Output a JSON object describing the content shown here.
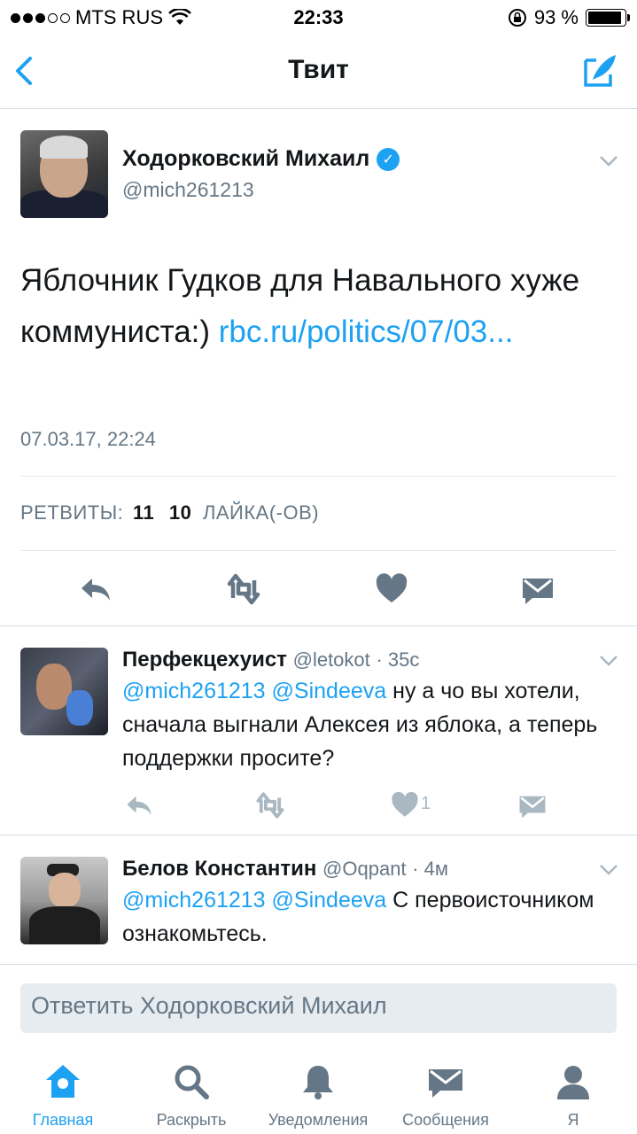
{
  "status_bar": {
    "carrier": "MTS RUS",
    "time": "22:33",
    "battery": "93 %",
    "battery_level": 0.93
  },
  "navbar": {
    "title": "Твит"
  },
  "main_tweet": {
    "name": "Ходорковский Михаил",
    "handle": "@mich261213",
    "text_plain": "Яблочник Гудков для Навального хуже коммуниста:) ",
    "text_link": "rbc.ru/politics/07/03...",
    "date": "07.03.17, 22:24",
    "retweets_label": "РЕТВИТЫ:",
    "retweets_count": "11",
    "likes_count": "10",
    "likes_label": "ЛАЙКА(-ОВ)"
  },
  "replies": [
    {
      "name": "Перфекцехуист",
      "handle": "@letokot",
      "time": "· 35с",
      "mention1": "@mich261213",
      "mention2": "@Sindeeva",
      "text": " ну а чо вы хотели, сначала выгнали Алексея из яблока, а теперь поддержки просите?",
      "likes": "1"
    },
    {
      "name": "Белов Константин",
      "handle": "@Oqpant",
      "time": "· 4м",
      "mention1": "@mich261213",
      "mention2": "@Sindeeva",
      "text": " С первоисточником ознакомьтесь."
    }
  ],
  "reply_bar": {
    "placeholder": "Ответить Ходорковский Михаил"
  },
  "tabbar": {
    "home": "Главная",
    "explore": "Раскрыть",
    "notifications": "Уведомления",
    "messages": "Сообщения",
    "me": "Я"
  },
  "colors": {
    "accent": "#1da1f2",
    "secondary_text": "#657786",
    "divider": "#e1e8ed"
  }
}
